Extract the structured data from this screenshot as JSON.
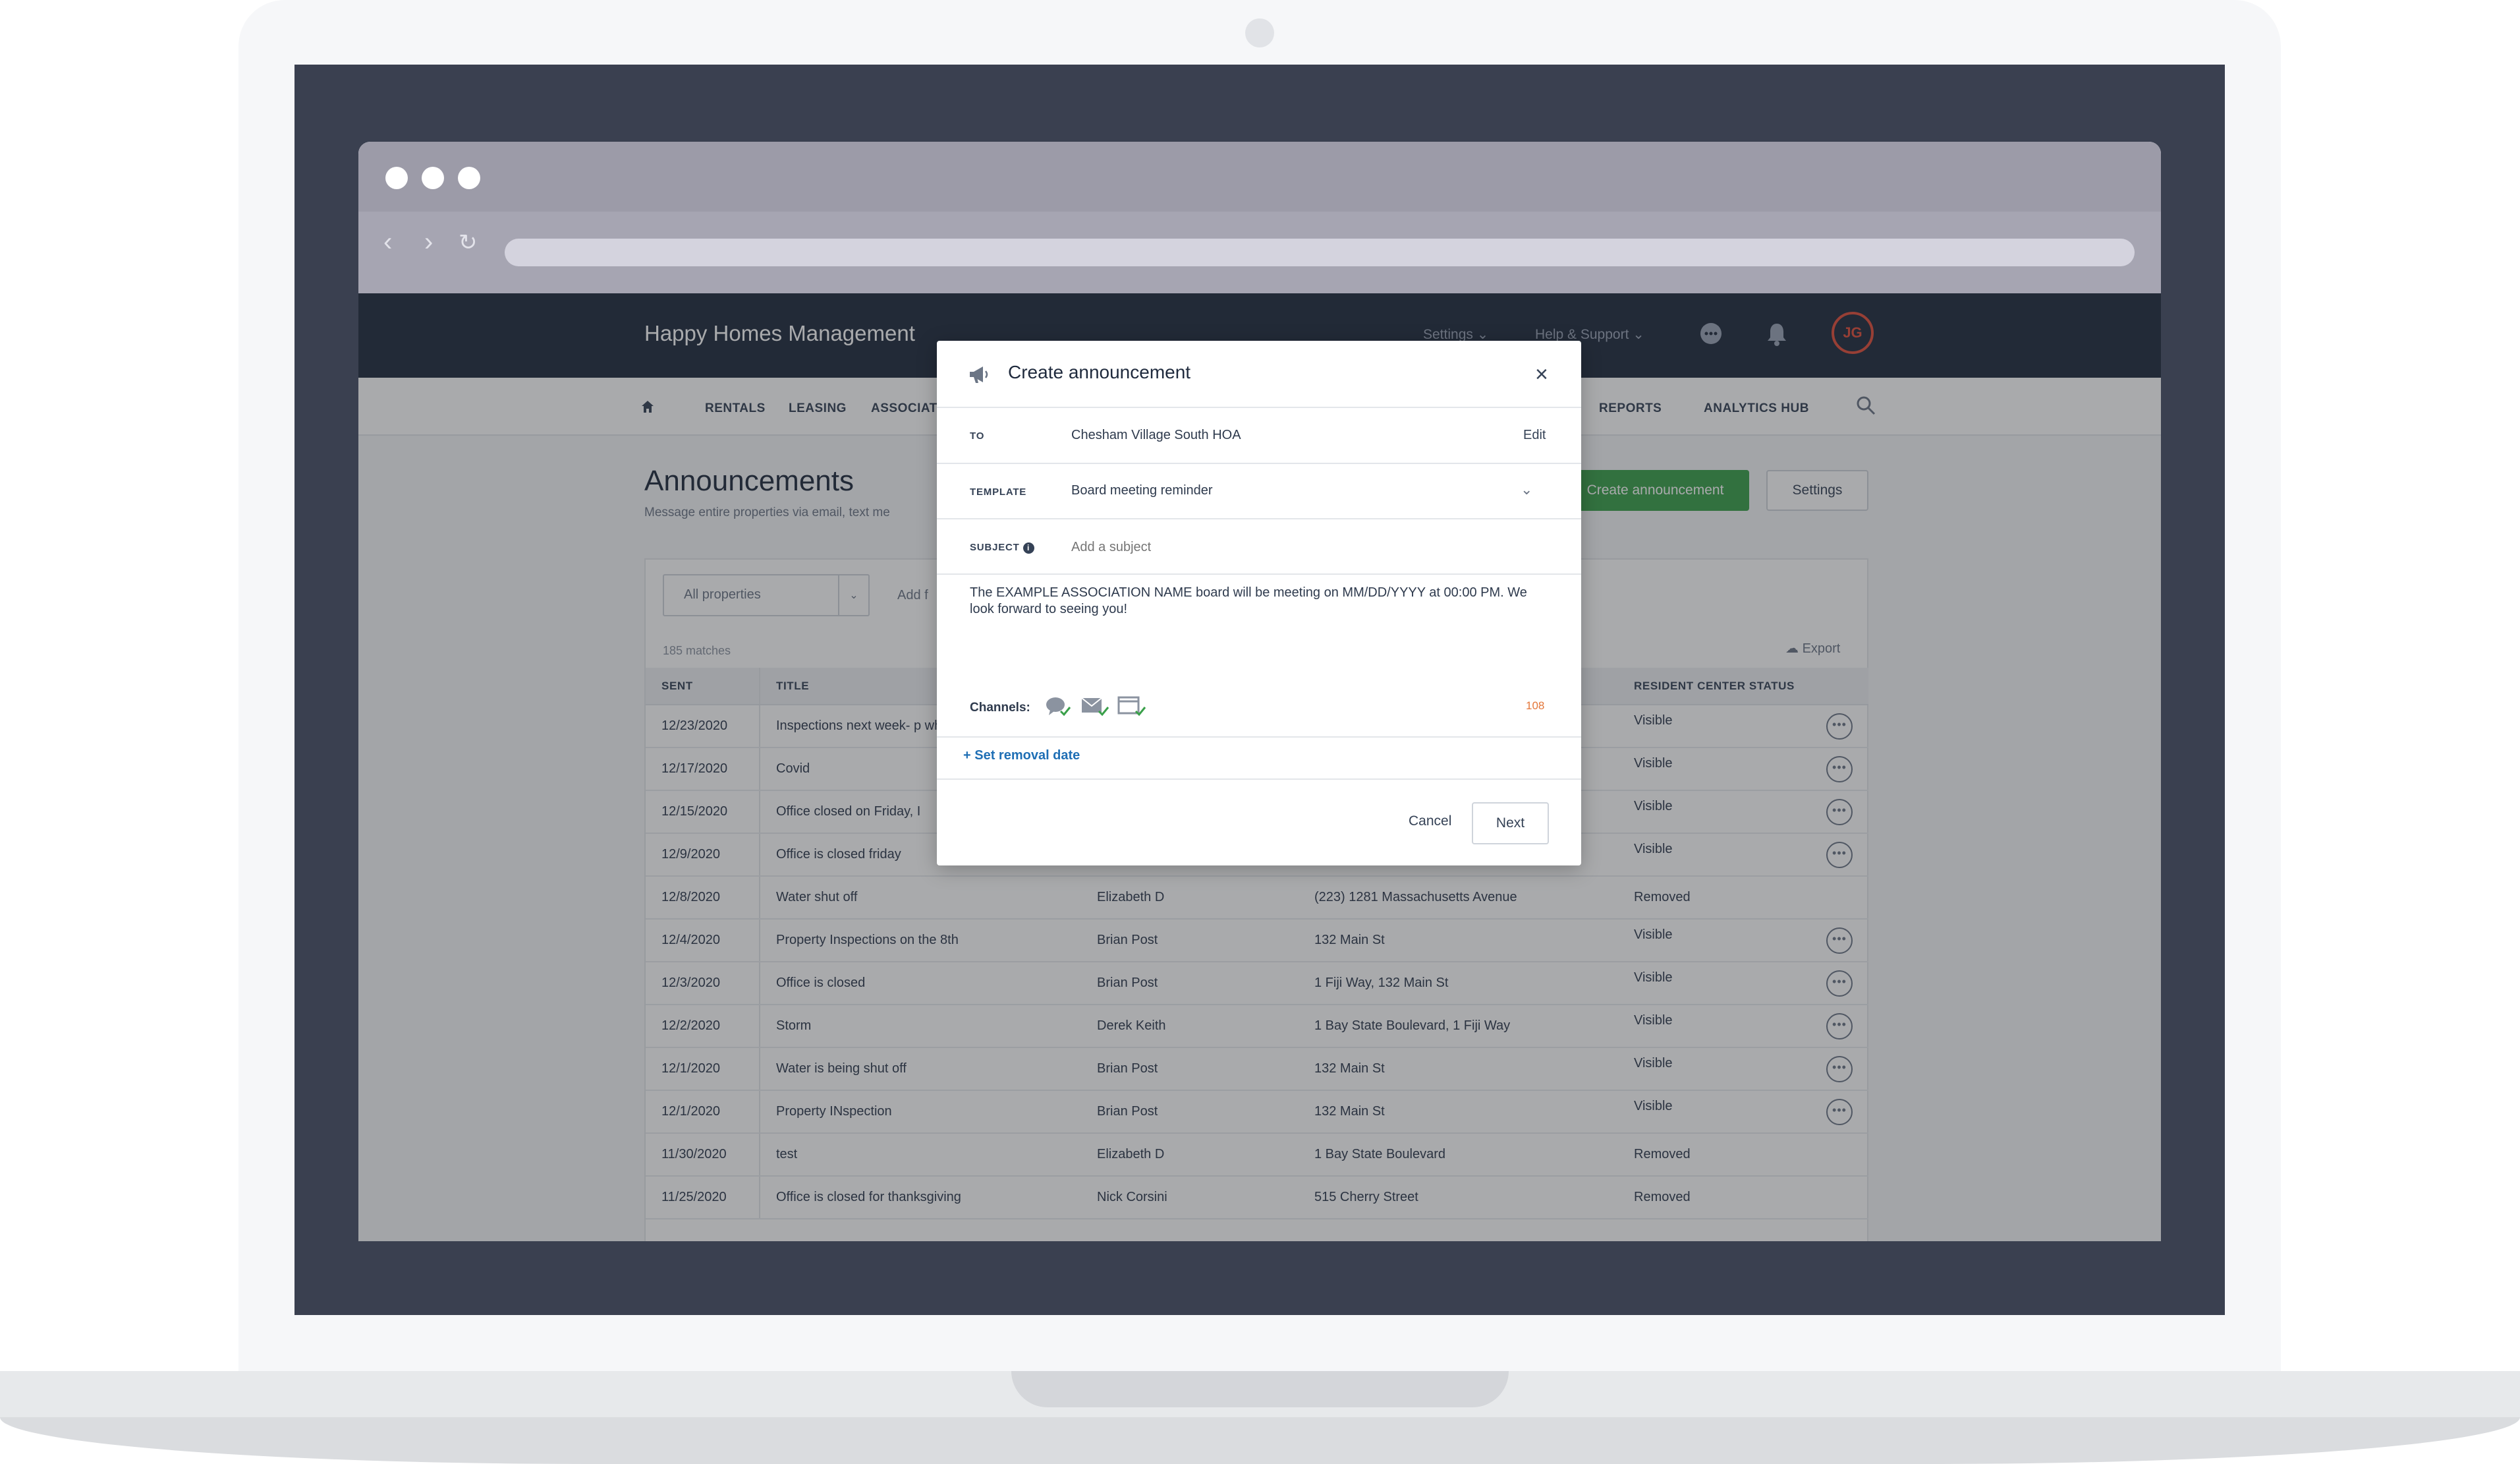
{
  "brand": {
    "title": "Happy Homes Management"
  },
  "topbar": {
    "settings_label": "Settings",
    "help_label": "Help & Support",
    "avatar_initials": "JG"
  },
  "subnav": {
    "items": [
      "RENTALS",
      "LEASING",
      "ASSOCIAT",
      "REPORTS",
      "ANALYTICS HUB"
    ]
  },
  "page": {
    "title": "Announcements",
    "subtitle": "Message entire properties via email, text me",
    "create_label": "Create announcement",
    "settings_label": "Settings"
  },
  "filters": {
    "property_value": "All properties",
    "add_filter": "Add f",
    "matches": "185 matches",
    "export_label": "Export"
  },
  "table": {
    "headers": [
      "SENT",
      "TITLE",
      "",
      "",
      "RESIDENT CENTER STATUS"
    ],
    "rows": [
      {
        "sent": "12/23/2020",
        "title": "Inspections next week- p when works!",
        "author": "",
        "location": "",
        "status": "Visible",
        "menu": true
      },
      {
        "sent": "12/17/2020",
        "title": "Covid",
        "author": "",
        "location": "",
        "status": "Visible",
        "menu": true
      },
      {
        "sent": "12/15/2020",
        "title": "Office closed on Friday, I",
        "author": "",
        "location": "",
        "status": "Visible",
        "menu": true
      },
      {
        "sent": "12/9/2020",
        "title": "Office is closed friday",
        "author": "",
        "location": "",
        "status": "Visible",
        "menu": true
      },
      {
        "sent": "12/8/2020",
        "title": "Water shut off",
        "author": "Elizabeth D",
        "location": "(223) 1281 Massachusetts Avenue",
        "status": "Removed",
        "menu": false
      },
      {
        "sent": "12/4/2020",
        "title": "Property Inspections on the 8th",
        "author": "Brian Post",
        "location": "132 Main St",
        "status": "Visible",
        "menu": true
      },
      {
        "sent": "12/3/2020",
        "title": "Office is closed",
        "author": "Brian Post",
        "location": "1 Fiji Way, 132 Main St",
        "status": "Visible",
        "menu": true
      },
      {
        "sent": "12/2/2020",
        "title": "Storm",
        "author": "Derek Keith",
        "location": "1 Bay State Boulevard, 1 Fiji Way",
        "status": "Visible",
        "menu": true
      },
      {
        "sent": "12/1/2020",
        "title": "Water is being shut off",
        "author": "Brian Post",
        "location": "132 Main St",
        "status": "Visible",
        "menu": true
      },
      {
        "sent": "12/1/2020",
        "title": "Property INspection",
        "author": "Brian Post",
        "location": "132 Main St",
        "status": "Visible",
        "menu": true
      },
      {
        "sent": "11/30/2020",
        "title": "test",
        "author": "Elizabeth D",
        "location": "1 Bay State Boulevard",
        "status": "Removed",
        "menu": false
      },
      {
        "sent": "11/25/2020",
        "title": "Office is closed for thanksgiving",
        "author": "Nick Corsini",
        "location": "515 Cherry Street",
        "status": "Removed",
        "menu": false
      }
    ]
  },
  "modal": {
    "title": "Create announcement",
    "to_label": "TO",
    "to_value": "Chesham Village South HOA",
    "edit_label": "Edit",
    "template_label": "TEMPLATE",
    "template_value": "Board meeting reminder",
    "subject_label": "SUBJECT",
    "subject_placeholder": "Add a subject",
    "body": "The EXAMPLE ASSOCIATION NAME board will be meeting on MM/DD/YYYY at 00:00 PM. We look forward to seeing you!",
    "channels_label": "Channels:",
    "char_count": "108",
    "removal_label": "+ Set removal date",
    "cancel_label": "Cancel",
    "next_label": "Next"
  },
  "colors": {
    "topbar": "#1f2a3d",
    "accent_green": "#3aa04a",
    "avatar_ring": "#e24d3a",
    "link_blue": "#1f6fb5",
    "counter_orange": "#e4773a"
  }
}
